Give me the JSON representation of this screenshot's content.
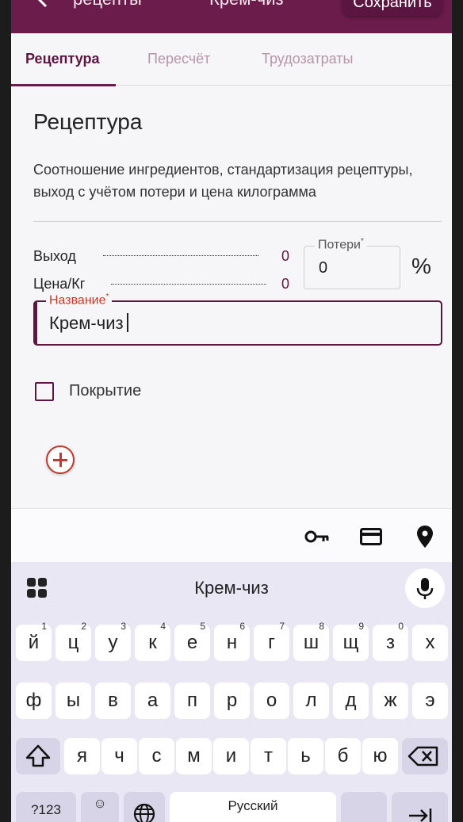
{
  "app_bar": {
    "back_label": "рецепты",
    "title": "Крем-чиз",
    "save_label": "Сохранить"
  },
  "tabs": [
    {
      "label": "Рецептура",
      "active": true
    },
    {
      "label": "Пересчёт",
      "active": false
    },
    {
      "label": "Трудозатраты",
      "active": false
    }
  ],
  "section": {
    "title": "Рецептура",
    "description": "Соотношение ингредиентов, стандартизация рецептуры, выход с учётом потери и цена килограмма"
  },
  "summary": {
    "yield_label": "Выход",
    "yield_value": "0",
    "price_label": "Цена/Кг",
    "price_value": "0"
  },
  "loss_field": {
    "label": "Потери",
    "required_mark": "*",
    "value": "0",
    "unit": "%"
  },
  "name_field": {
    "label": "Название",
    "required_mark": "*",
    "value": "Крем-чиз"
  },
  "coating_checkbox": {
    "label": "Покрытие",
    "checked": false
  },
  "keyboard": {
    "suggestion": "Крем-чиз",
    "row1": [
      {
        "key": "й",
        "hint": "1"
      },
      {
        "key": "ц",
        "hint": "2"
      },
      {
        "key": "у",
        "hint": "3"
      },
      {
        "key": "к",
        "hint": "4"
      },
      {
        "key": "е",
        "hint": "5"
      },
      {
        "key": "н",
        "hint": "6"
      },
      {
        "key": "г",
        "hint": "7"
      },
      {
        "key": "ш",
        "hint": "8"
      },
      {
        "key": "щ",
        "hint": "9"
      },
      {
        "key": "з",
        "hint": "0"
      },
      {
        "key": "х",
        "hint": ""
      }
    ],
    "row2": [
      "ф",
      "ы",
      "в",
      "а",
      "п",
      "р",
      "о",
      "л",
      "д",
      "ж",
      "э"
    ],
    "row3": [
      "я",
      "ч",
      "с",
      "м",
      "и",
      "т",
      "ь",
      "б",
      "ю"
    ],
    "row4": {
      "symbols_label": "?123",
      "emoji_label": "☺",
      "space_label": "Русский"
    }
  },
  "colors": {
    "brand": "#6b1c4b",
    "accent_red": "#c0392b",
    "keyboard_bg": "#e9e7f4"
  }
}
